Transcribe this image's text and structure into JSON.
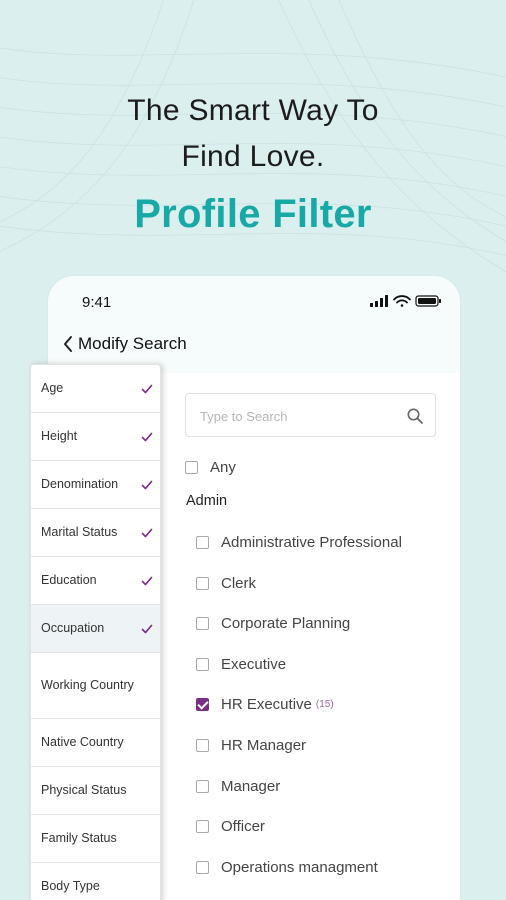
{
  "promo": {
    "headline_line1": "The Smart Way To",
    "headline_line2": "Find Love.",
    "feature_title": "Profile Filter"
  },
  "status_bar": {
    "time": "9:41"
  },
  "header": {
    "back_label": "Modify Search"
  },
  "sidebar": {
    "items": [
      {
        "label": "Age",
        "checked": true
      },
      {
        "label": "Height",
        "checked": true
      },
      {
        "label": "Denomination",
        "checked": true
      },
      {
        "label": "Marital Status",
        "checked": true
      },
      {
        "label": "Education",
        "checked": true
      },
      {
        "label": "Occupation",
        "checked": true,
        "active": true
      },
      {
        "label": "Working Country",
        "checked": false
      },
      {
        "label": "Native Country",
        "checked": false
      },
      {
        "label": "Physical Status",
        "checked": false
      },
      {
        "label": "Family Status",
        "checked": false
      },
      {
        "label": "Body Type",
        "checked": false
      }
    ]
  },
  "search": {
    "placeholder": "Type to Search"
  },
  "filter": {
    "any_label": "Any",
    "group_label": "Admin",
    "options": [
      {
        "label": "Administrative Professional",
        "checked": false
      },
      {
        "label": "Clerk",
        "checked": false
      },
      {
        "label": "Corporate Planning",
        "checked": false
      },
      {
        "label": "Executive",
        "checked": false
      },
      {
        "label": "HR Executive",
        "checked": true,
        "count": "(15)"
      },
      {
        "label": "HR Manager",
        "checked": false
      },
      {
        "label": "Manager",
        "checked": false
      },
      {
        "label": "Officer",
        "checked": false
      },
      {
        "label": "Operations managment",
        "checked": false
      }
    ]
  },
  "colors": {
    "background": "#dcefef",
    "brand_teal": "#16a9a5",
    "accent_purple": "#7a2f84"
  }
}
